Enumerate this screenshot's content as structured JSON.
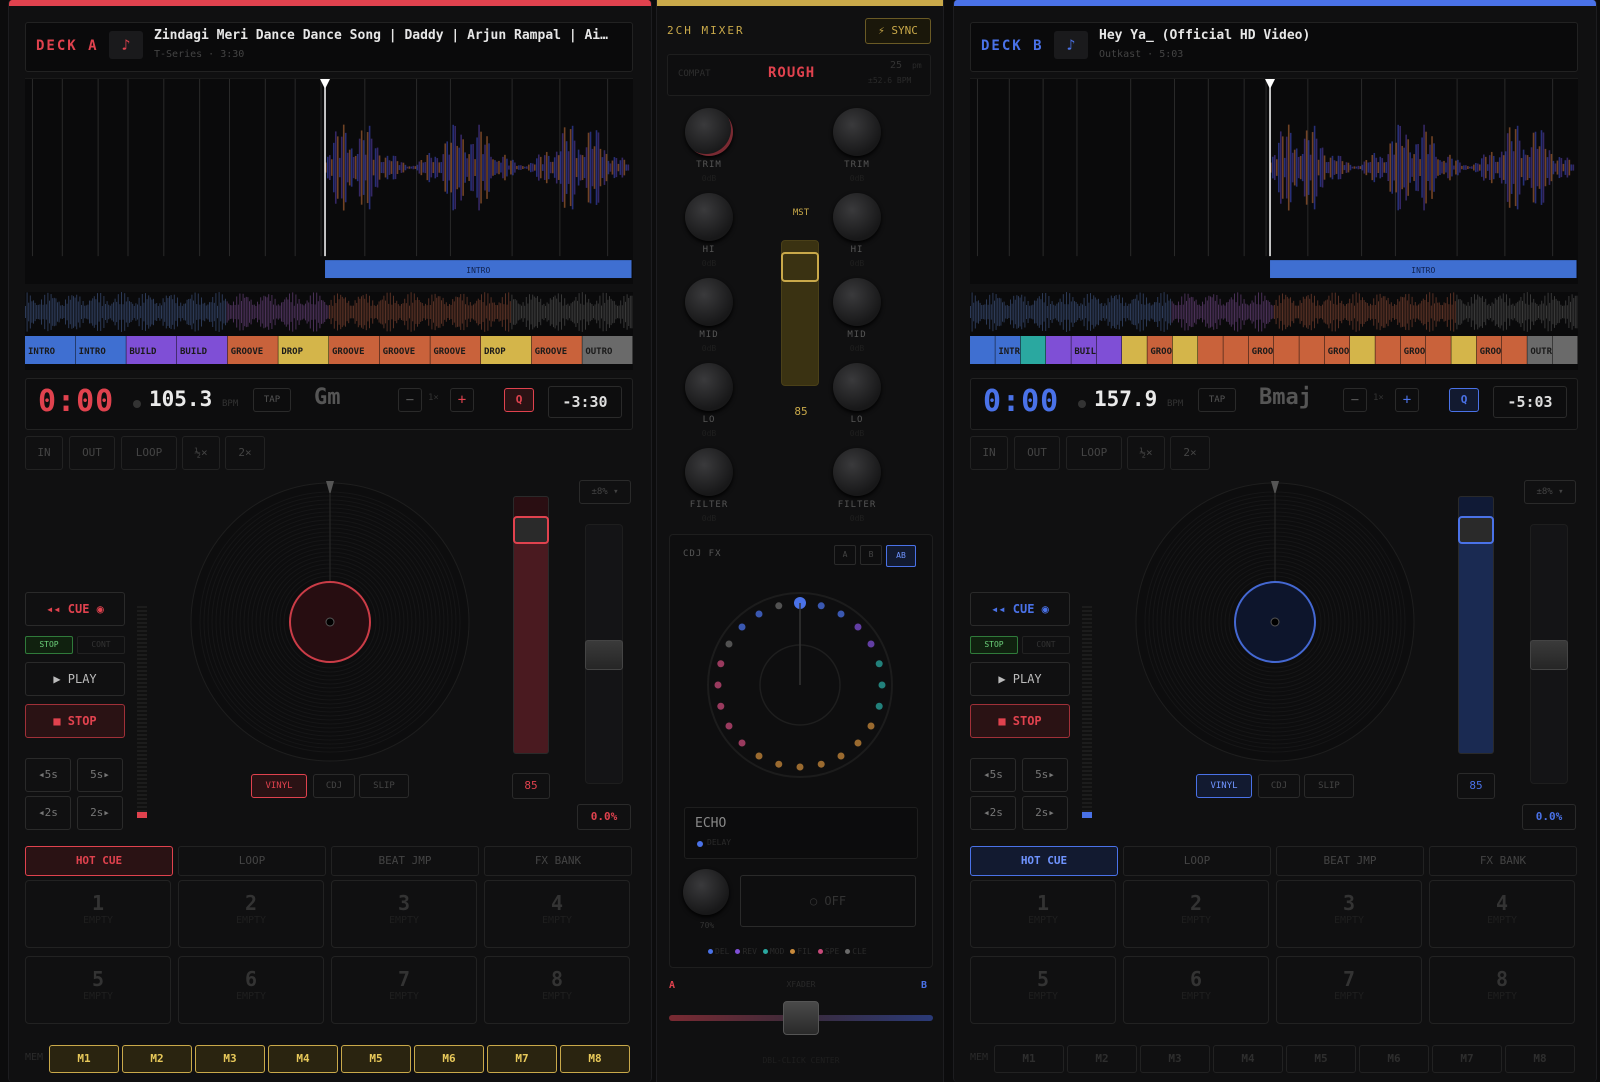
{
  "decks": [
    {
      "id": "a",
      "label": "DECK A",
      "note_icon": "music-note-icon",
      "title": "Zindagi Meri Dance Dance Song | Daddy | Arjun Rampal | Ai…",
      "artist_time": "T-Series · 3:30",
      "segment_label": "INTRO",
      "overview_segments": [
        "INTRO",
        "INTRO",
        "BUILD",
        "BUILD",
        "GROOVE",
        "DROP",
        "GROOVE",
        "GROOVE",
        "GROOVE",
        "DROP",
        "GROOVE",
        "OUTRO"
      ],
      "time": "0:00",
      "bpm": "105.3",
      "bpm_unit": "BPM",
      "tap": "TAP",
      "key": "Gm",
      "minus": "−",
      "speed": "1×",
      "plus": "+",
      "q": "Q",
      "remain": "-3:30",
      "loop_buttons": [
        "IN",
        "OUT",
        "LOOP",
        "½×",
        "2×"
      ],
      "cue": "◂◂ CUE ◉",
      "stop_small": "STOP",
      "cont_small": "CONT",
      "play": "▶ PLAY",
      "stop": "■ STOP",
      "seek": [
        "◂5s",
        "5s▸",
        "◂2s",
        "2s▸"
      ],
      "modes": [
        "VINYL",
        "CDJ",
        "SLIP"
      ],
      "pitch_value": "85",
      "range": "±8% ▾",
      "tempo": "0.0%",
      "tabs": [
        "HOT CUE",
        "LOOP",
        "BEAT JMP",
        "FX BANK"
      ],
      "pads": [
        {
          "n": "1",
          "s": "EMPTY"
        },
        {
          "n": "2",
          "s": "EMPTY"
        },
        {
          "n": "3",
          "s": "EMPTY"
        },
        {
          "n": "4",
          "s": "EMPTY"
        },
        {
          "n": "5",
          "s": "EMPTY"
        },
        {
          "n": "6",
          "s": "EMPTY"
        },
        {
          "n": "7",
          "s": "EMPTY"
        },
        {
          "n": "8",
          "s": "EMPTY"
        }
      ],
      "mem_label": "MEM",
      "mems": [
        "M1",
        "M2",
        "M3",
        "M4",
        "M5",
        "M6",
        "M7",
        "M8"
      ],
      "accent": "#e0424e",
      "pitch_level": 0.85,
      "mem_active": true
    },
    {
      "id": "b",
      "label": "DECK B",
      "note_icon": "music-note-icon",
      "title": "Hey Ya_ (Official HD Video)",
      "artist_time": "Outkast · 5:03",
      "segment_label": "INTRO",
      "overview_segments": [
        "",
        "INTR",
        "",
        "",
        "BUIL",
        "",
        "",
        "GROO",
        "",
        "",
        "",
        "GROO",
        "",
        "",
        "GROO",
        "",
        "",
        "GROO",
        "",
        "",
        "GROO",
        "",
        "OUTR",
        ""
      ],
      "time": "0:00",
      "bpm": "157.9",
      "bpm_unit": "BPM",
      "tap": "TAP",
      "key": "Bmaj",
      "minus": "−",
      "speed": "1×",
      "plus": "+",
      "q": "Q",
      "remain": "-5:03",
      "loop_buttons": [
        "IN",
        "OUT",
        "LOOP",
        "½×",
        "2×"
      ],
      "cue": "◂◂ CUE ◉",
      "stop_small": "STOP",
      "cont_small": "CONT",
      "play": "▶ PLAY",
      "stop": "■ STOP",
      "seek": [
        "◂5s",
        "5s▸",
        "◂2s",
        "2s▸"
      ],
      "modes": [
        "VINYL",
        "CDJ",
        "SLIP"
      ],
      "pitch_value": "85",
      "range": "±8% ▾",
      "tempo": "0.0%",
      "tabs": [
        "HOT CUE",
        "LOOP",
        "BEAT JMP",
        "FX BANK"
      ],
      "pads": [
        {
          "n": "1",
          "s": "EMPTY"
        },
        {
          "n": "2",
          "s": "EMPTY"
        },
        {
          "n": "3",
          "s": "EMPTY"
        },
        {
          "n": "4",
          "s": "EMPTY"
        },
        {
          "n": "5",
          "s": "EMPTY"
        },
        {
          "n": "6",
          "s": "EMPTY"
        },
        {
          "n": "7",
          "s": "EMPTY"
        },
        {
          "n": "8",
          "s": "EMPTY"
        }
      ],
      "mem_label": "MEM",
      "mems": [
        "M1",
        "M2",
        "M3",
        "M4",
        "M5",
        "M6",
        "M7",
        "M8"
      ],
      "accent": "#4a72e8",
      "pitch_level": 0.85,
      "mem_active": false
    }
  ],
  "mixer": {
    "title": "2CH MIXER",
    "sync": "⚡ SYNC",
    "compat_label": "COMPAT",
    "compat_value": "ROUGH",
    "bpm_diff_a": "25",
    "bpm_diff_unit": "pm",
    "bpm_diff_b": "±52.6 BPM",
    "knobs": [
      "TRIM",
      "HI",
      "MID",
      "LO",
      "FILTER"
    ],
    "knob_sub": "0dB",
    "mst": "MST",
    "master_value": "85",
    "master_level": 0.85,
    "fx_label": "CDJ FX",
    "fx_targets": [
      "A",
      "B",
      "AB"
    ],
    "fx_name": "ECHO",
    "fx_sub": "DELAY",
    "fx_wet": "70%",
    "fx_off": "○ OFF",
    "fx_legend": [
      "DEL",
      "REV",
      "MOD",
      "FIL",
      "SPE",
      "CLE"
    ],
    "xfader_a": "A",
    "xfader_label": "XFADER",
    "xfader_b": "B",
    "xfader_hint": "DBL-CLICK CENTER",
    "xfader_pos": 0.5
  },
  "colors": {
    "intro": "#3f6fd1",
    "build": "#7f4fd6",
    "groove": "#c9623b",
    "drop": "#d4b54a",
    "outro": "#6a6a6a",
    "teal": "#2aa8a0"
  }
}
